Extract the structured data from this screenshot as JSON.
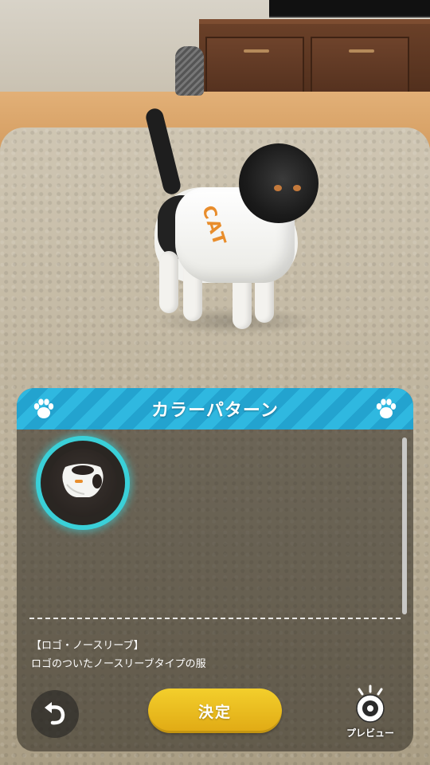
{
  "panel": {
    "title": "カラーパターン"
  },
  "item": {
    "name": "【ロゴ・ノースリーブ】",
    "description": "ロゴのついたノースリーブタイプの服"
  },
  "shirt": {
    "logo_text": "CAT",
    "logo_color": "#e88d2c"
  },
  "actions": {
    "confirm_label": "決定",
    "preview_label": "プレビュー",
    "back_icon": "undo-arrow-icon",
    "preview_icon": "eye-icon"
  },
  "colors": {
    "header_blue": "#2fb8e0",
    "selection_glow": "#3ad0d8",
    "confirm_yellow": "#f3cf2c"
  }
}
